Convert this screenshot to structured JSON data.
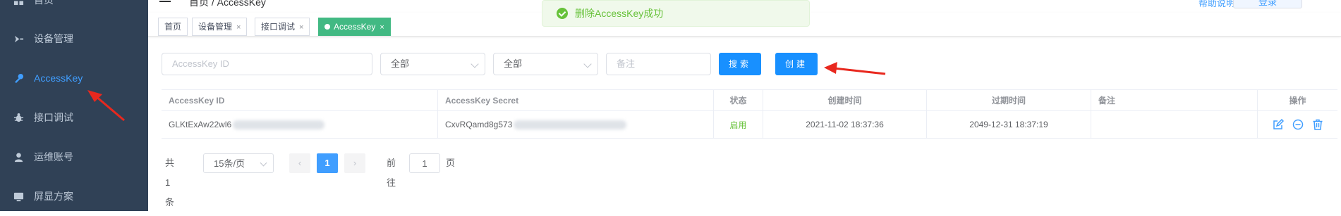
{
  "sidebar": {
    "items": [
      {
        "label": "首页",
        "icon": "dashboard-icon"
      },
      {
        "label": "设备管理",
        "icon": "device-icon"
      },
      {
        "label": "AccessKey",
        "icon": "key-icon",
        "active": true
      },
      {
        "label": "接口调试",
        "icon": "bug-icon"
      },
      {
        "label": "运维账号",
        "icon": "user-icon"
      },
      {
        "label": "屏显方案",
        "icon": "screen-icon"
      }
    ],
    "colors": {
      "background": "#304156",
      "text": "#bfcbd9",
      "active": "#409eff"
    }
  },
  "header": {
    "breadcrumb": "首页 / AccessKey",
    "right_link": "帮助说明",
    "right_button": "登录"
  },
  "tags": [
    {
      "label": "首页",
      "closable": false
    },
    {
      "label": "设备管理",
      "closable": true
    },
    {
      "label": "接口调试",
      "closable": true
    },
    {
      "label": "AccessKey",
      "closable": true,
      "active": true
    }
  ],
  "toast": {
    "message": "删除AccessKey成功",
    "color": "#67c23a"
  },
  "filters": {
    "access_key_placeholder": "AccessKey ID",
    "select1_value": "全部",
    "select2_value": "全部",
    "remark_placeholder": "备注",
    "search_label": "搜索",
    "create_label": "创建"
  },
  "table": {
    "columns": [
      "AccessKey ID",
      "AccessKey Secret",
      "状态",
      "创建时间",
      "过期时间",
      "备注",
      "操作"
    ],
    "rows": [
      {
        "id": "GLKtExAw22wl6",
        "secret": "CxvRQamd8g573",
        "status": "启用",
        "created": "2021-11-02 18:37:36",
        "expires": "2049-12-31 18:37:19",
        "remark": "",
        "actions": [
          "edit-icon",
          "disable-icon",
          "delete-icon"
        ]
      }
    ]
  },
  "pagination": {
    "total": "共 1 条",
    "page_size": "15条/页",
    "current_page": "1",
    "goto_label": "前往",
    "goto_value": "1",
    "page_suffix": "页"
  },
  "annotations": {
    "arrow_color": "#e8281e"
  }
}
